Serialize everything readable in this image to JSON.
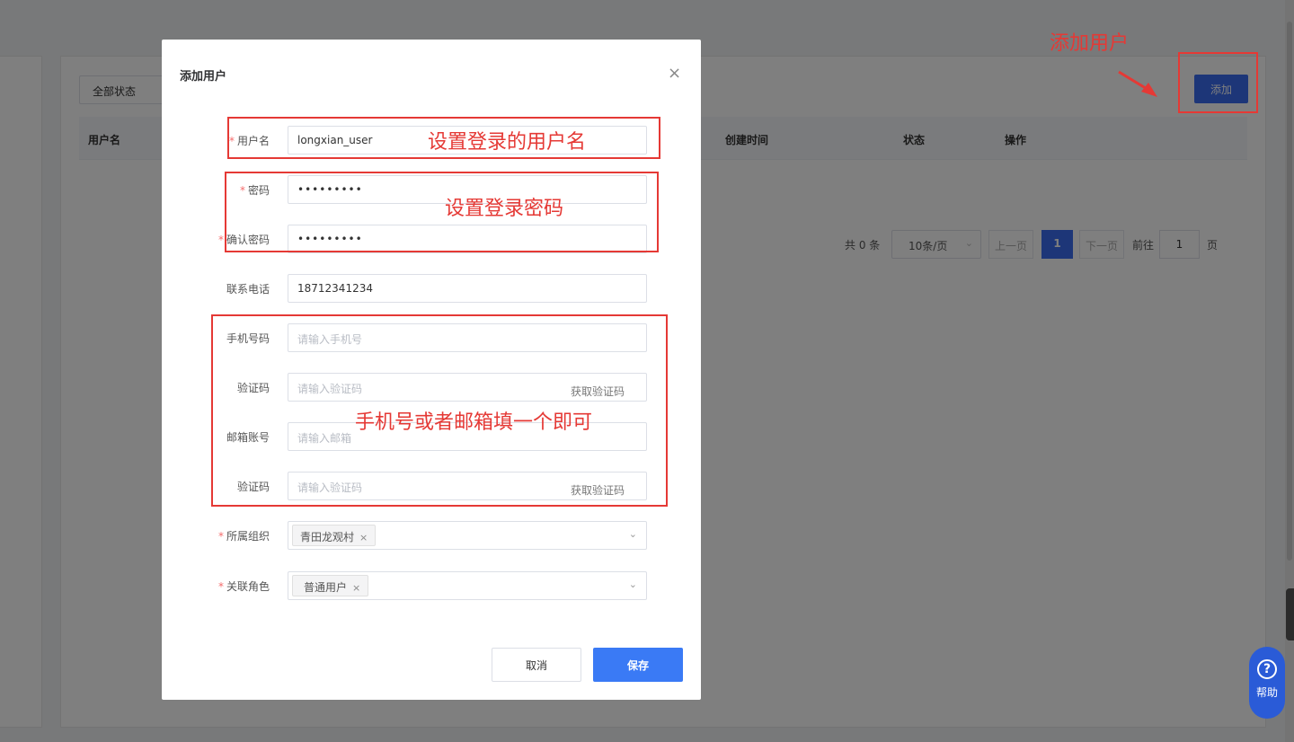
{
  "background": {
    "status_filter": "全部状态",
    "columns": [
      {
        "label": "用户名"
      },
      {
        "label": "创建时间"
      },
      {
        "label": "状态"
      },
      {
        "label": "操作"
      }
    ],
    "add_button": "添加",
    "pagination": {
      "total": "共 0 条",
      "page_size": "10条/页",
      "prev": "上一页",
      "current": "1",
      "next": "下一页",
      "goto": "前往",
      "goto_value": "1",
      "page_suffix": "页"
    },
    "help_label": "帮助"
  },
  "dialog": {
    "title": "添加用户",
    "close_symbol": "×",
    "fields": {
      "username": {
        "label": "用户名",
        "value": "longxian_user"
      },
      "password": {
        "label": "密码",
        "value": "•••••••••"
      },
      "confirm_password": {
        "label": "确认密码",
        "value": "•••••••••"
      },
      "phone": {
        "label": "联系电话",
        "value": "18712341234"
      },
      "mobile": {
        "label": "手机号码",
        "placeholder": "请输入手机号"
      },
      "mobile_code": {
        "label": "验证码",
        "placeholder": "请输入验证码",
        "button": "获取验证码"
      },
      "email": {
        "label": "邮箱账号",
        "placeholder": "请输入邮箱"
      },
      "email_code": {
        "label": "验证码",
        "placeholder": "请输入验证码",
        "button": "获取验证码"
      },
      "organization": {
        "label": "所属组织",
        "tag": "青田龙观村"
      },
      "role": {
        "label": "关联角色",
        "tag": "普通用户"
      }
    },
    "cancel": "取消",
    "save": "保存"
  },
  "annotations": {
    "add_user": "添加用户",
    "set_username": "设置登录的用户名",
    "set_password": "设置登录密码",
    "phone_or_email": "手机号或者邮箱填一个即可"
  },
  "colors": {
    "accent": "#3a6df0",
    "annotation": "#e53935",
    "required": "#f56c6c"
  }
}
